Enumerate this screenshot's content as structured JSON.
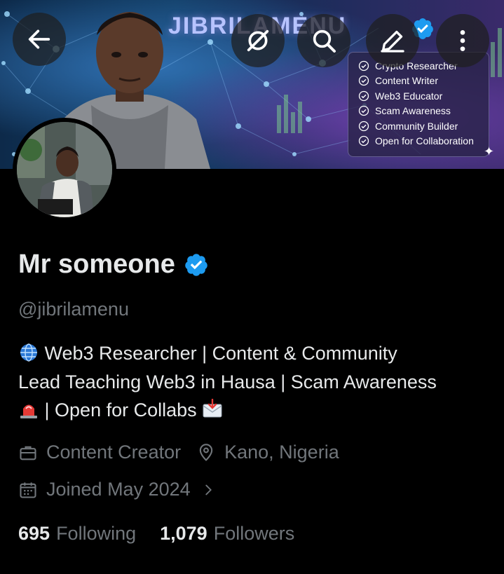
{
  "header": {
    "brand_text": "JIBRILAMENU",
    "buttons": [
      "back",
      "grok",
      "search",
      "edit",
      "more"
    ]
  },
  "banner_card": {
    "items": [
      "Crypto Researcher",
      "Content Writer",
      "Web3 Educator",
      "Scam Awareness",
      "Community Builder",
      "Open for Collaboration"
    ]
  },
  "profile": {
    "name": "Mr someone",
    "handle": "@jibrilamenu",
    "bio_line1": "Web3 Researcher | Content & Community",
    "bio_line2": "Lead Teaching Web3 in Hausa | Scam Awareness",
    "bio_line3": "| Open for Collabs",
    "category": "Content Creator",
    "location": "Kano, Nigeria",
    "joined": "Joined May 2024"
  },
  "stats": {
    "following_count": "695",
    "following_label": "Following",
    "followers_count": "1,079",
    "followers_label": "Followers"
  },
  "colors": {
    "background": "#000000",
    "text_primary": "#e7e9ea",
    "text_secondary": "#71767b",
    "verified_blue": "#1d9bf0"
  }
}
